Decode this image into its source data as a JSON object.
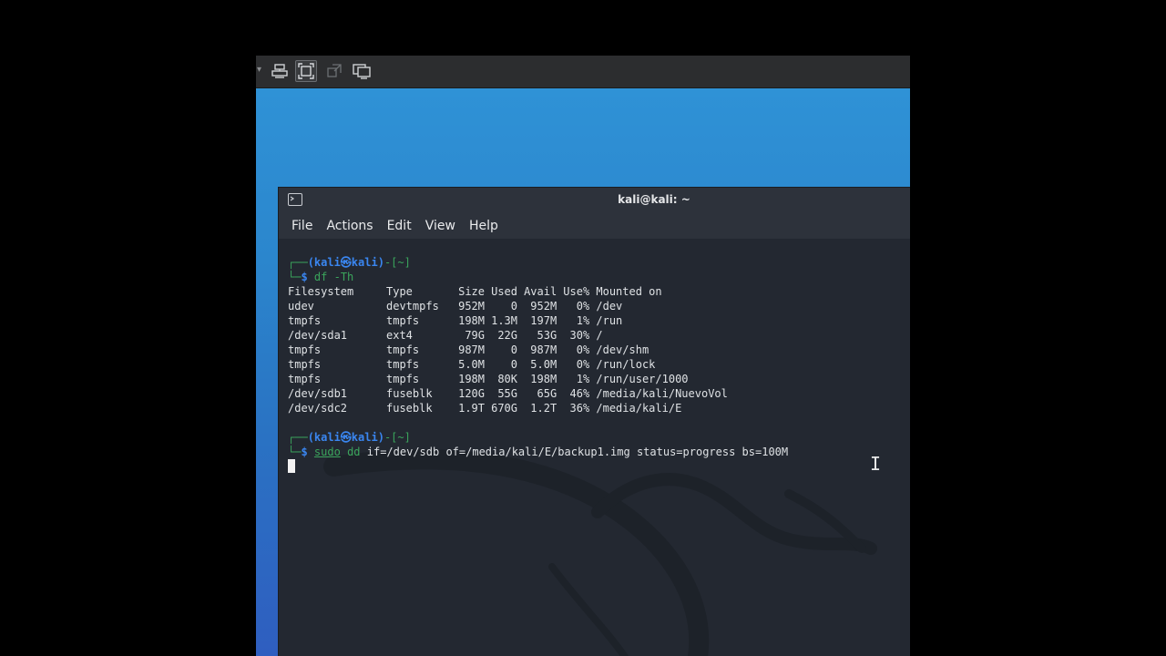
{
  "toolbar": {
    "buttons": [
      {
        "icon": "send-keys-icon"
      },
      {
        "icon": "fit-guest-icon",
        "active": true
      },
      {
        "icon": "unity-mode-icon"
      },
      {
        "icon": "console-view-icon"
      }
    ]
  },
  "terminal": {
    "title": "kali@kali: ~",
    "menu": [
      "File",
      "Actions",
      "Edit",
      "View",
      "Help"
    ],
    "prompt": {
      "corner_top": "┌──",
      "user_host": "(kali㉿kali)",
      "dash": "-",
      "dir": "[~]",
      "corner_bottom": "└─",
      "dollar": "$"
    },
    "command1": "df -Th",
    "df_header": [
      "Filesystem",
      "Type",
      "Size",
      "Used",
      "Avail",
      "Use%",
      "Mounted on"
    ],
    "df_rows": [
      [
        "udev",
        "devtmpfs",
        "952M",
        "0",
        "952M",
        "0%",
        "/dev"
      ],
      [
        "tmpfs",
        "tmpfs",
        "198M",
        "1.3M",
        "197M",
        "1%",
        "/run"
      ],
      [
        "/dev/sda1",
        "ext4",
        "79G",
        "22G",
        "53G",
        "30%",
        "/"
      ],
      [
        "tmpfs",
        "tmpfs",
        "987M",
        "0",
        "987M",
        "0%",
        "/dev/shm"
      ],
      [
        "tmpfs",
        "tmpfs",
        "5.0M",
        "0",
        "5.0M",
        "0%",
        "/run/lock"
      ],
      [
        "tmpfs",
        "tmpfs",
        "198M",
        "80K",
        "198M",
        "1%",
        "/run/user/1000"
      ],
      [
        "/dev/sdb1",
        "fuseblk",
        "120G",
        "55G",
        "65G",
        "46%",
        "/media/kali/NuevoVol"
      ],
      [
        "/dev/sdc2",
        "fuseblk",
        "1.9T",
        "670G",
        "1.2T",
        "36%",
        "/media/kali/E"
      ]
    ],
    "command2": {
      "sudo": "sudo",
      "dd": "dd",
      "args": "if=/dev/sdb of=/media/kali/E/backup1.img status=progress bs=100M"
    }
  },
  "colors": {
    "terminal_bg": "#232831",
    "prompt_blue": "#3a86f0",
    "prompt_green": "#3ba55c",
    "desktop_blue": "#2b86cd"
  }
}
